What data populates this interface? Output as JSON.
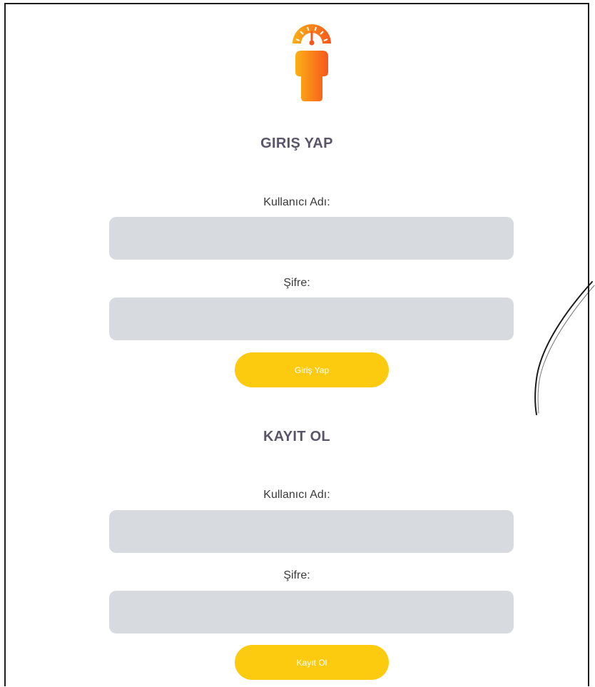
{
  "logo": {
    "icon": "gauge-person-icon",
    "gradient": [
      "#fbb016",
      "#f7571c"
    ]
  },
  "login": {
    "title": "GIRIŞ YAP",
    "username_label": "Kullanıcı Adı:",
    "username_value": "",
    "password_label": "Şifre:",
    "password_value": "",
    "submit_label": "Giriş Yap"
  },
  "register": {
    "title": "KAYIT OL",
    "username_label": "Kullanıcı Adı:",
    "username_value": "",
    "password_label": "Şifre:",
    "password_value": "",
    "submit_label": "Kayıt Ol"
  },
  "colors": {
    "accent": "#fccb10",
    "input_bg": "#d7dbdf",
    "title_text": "#5a5568"
  }
}
